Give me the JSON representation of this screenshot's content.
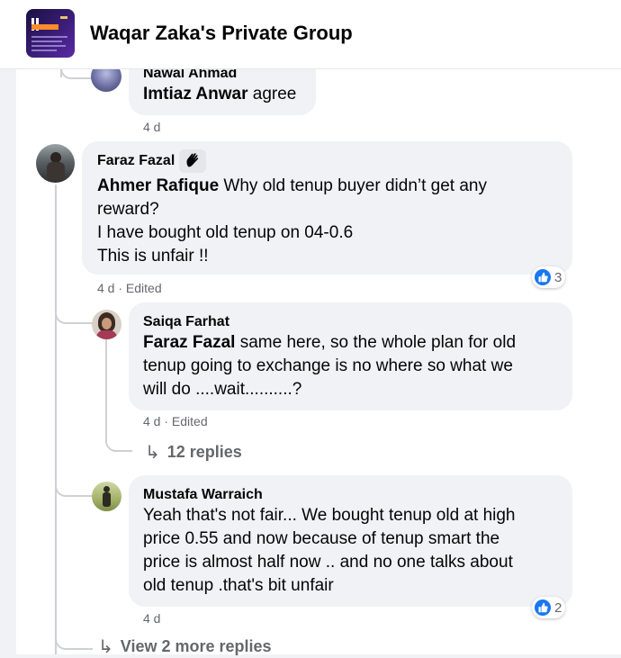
{
  "header": {
    "group_name": "Waqar Zaka's Private Group"
  },
  "comments": [
    {
      "author": "Nawal Ahmad",
      "mention": "Imtiaz Anwar",
      "text": " agree",
      "meta": "4 d"
    },
    {
      "author": "Faraz Fazal",
      "mention": "Ahmer Rafique",
      "lines": [
        " Why old tenup buyer didn’t get any",
        "reward?",
        "I have bought old tenup on 04-0.6",
        "This is unfair !!"
      ],
      "meta": "4 d · Edited",
      "reactions": {
        "icon": "like-icon",
        "count": "3"
      }
    },
    {
      "author": "Saiqa Farhat",
      "mention": "Faraz Fazal",
      "lines": [
        " same here, so the whole plan for old",
        "tenup going to exchange is no where so what we",
        "will do ....wait..........?"
      ],
      "meta": "4 d · Edited",
      "replies_label": "12 replies"
    },
    {
      "author": "Mustafa Warraich",
      "lines": [
        "Yeah that's not fair... We bought tenup old at high",
        "price 0.55 and now because of tenup smart the",
        "price is almost half now .. and no one talks about",
        "old tenup .that's bit unfair"
      ],
      "meta": "4 d",
      "reactions": {
        "icon": "like-icon",
        "count": "2"
      }
    }
  ],
  "view_more_label": "View 2 more replies"
}
